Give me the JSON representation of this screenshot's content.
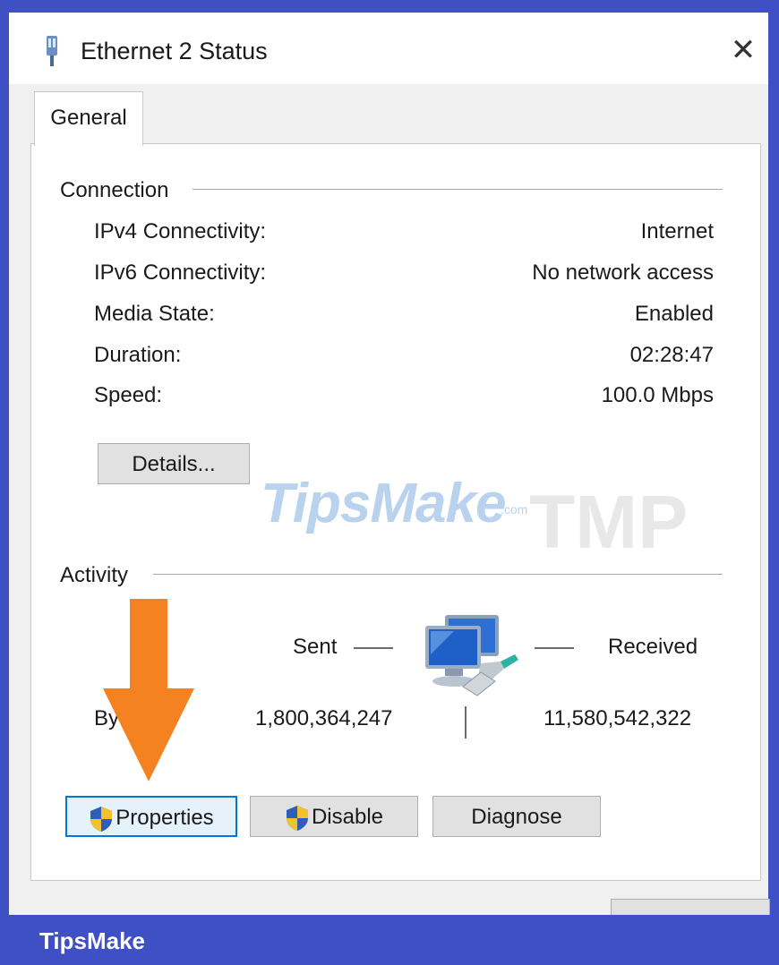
{
  "window": {
    "title": "Ethernet 2 Status",
    "close_glyph": "✕"
  },
  "tabs": [
    {
      "label": "General"
    }
  ],
  "connection": {
    "group_label": "Connection",
    "rows": [
      {
        "label": "IPv4 Connectivity:",
        "value": "Internet"
      },
      {
        "label": "IPv6 Connectivity:",
        "value": "No network access"
      },
      {
        "label": "Media State:",
        "value": "Enabled"
      },
      {
        "label": "Duration:",
        "value": "02:28:47"
      },
      {
        "label": "Speed:",
        "value": "100.0 Mbps"
      }
    ],
    "details_button": "Details..."
  },
  "activity": {
    "group_label": "Activity",
    "sent_label": "Sent",
    "received_label": "Received",
    "bytes_label": "By",
    "bytes_sent": "1,800,364,247",
    "bytes_received": "11,580,542,322"
  },
  "buttons": {
    "properties": "Properties",
    "disable": "Disable",
    "diagnose": "Diagnose"
  },
  "watermark": {
    "text": "TipsMake",
    "suffix": ".com",
    "tmp": "TMP"
  },
  "footer": {
    "brand": "TipsMake"
  },
  "colors": {
    "frame": "#3f4fc4",
    "arrow": "#f58220",
    "focus_border": "#0078d7"
  },
  "icons": {
    "title": "ethernet-adapter-icon",
    "activity": "network-computers-icon",
    "shield": "uac-shield-icon"
  }
}
